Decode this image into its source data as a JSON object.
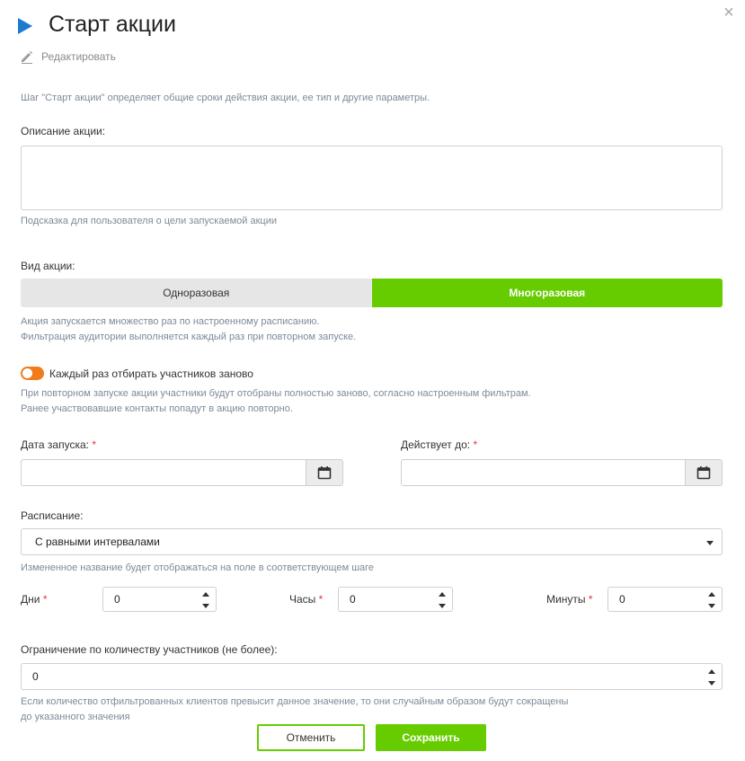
{
  "header": {
    "title": "Старт акции",
    "close_icon": "×",
    "edit_label": "Редактировать"
  },
  "intro_text": "Шаг \"Старт акции\" определяет общие сроки действия акции, ее тип и другие параметры.",
  "description": {
    "label": "Описание акции:",
    "value": "",
    "hint": "Подсказка для пользователя о цели запускаемой акции"
  },
  "type": {
    "label": "Вид акции:",
    "options": [
      "Одноразовая",
      "Многоразовая"
    ],
    "selected": "Многоразовая",
    "hint_line1": "Акция запускается множество раз по настроенному расписанию.",
    "hint_line2": "Фильтрация аудитории выполняется каждый раз при повторном запуске."
  },
  "reselect_toggle": {
    "label": "Каждый раз отбирать участников заново",
    "on": true,
    "hint_line1": "При повторном запуске акции участники будут отобраны полностью заново, согласно настроенным фильтрам.",
    "hint_line2": "Ранее участвовавшие контакты попадут в акцию повторно."
  },
  "start_date": {
    "label": "Дата запуска:",
    "required_mark": "*",
    "value": ""
  },
  "end_date": {
    "label": "Действует до:",
    "required_mark": "*",
    "value": ""
  },
  "schedule": {
    "label": "Расписание:",
    "selected": "С равными интервалами",
    "hint": "Измененное название будет отображаться на поле в соответствующем шаге"
  },
  "interval": {
    "days": {
      "label": "Дни",
      "required_mark": "*",
      "value": "0"
    },
    "hours": {
      "label": "Часы",
      "required_mark": "*",
      "value": "0"
    },
    "minutes": {
      "label": "Минуты",
      "required_mark": "*",
      "value": "0"
    }
  },
  "limit": {
    "label": "Ограничение по количеству участников (не более):",
    "value": "0",
    "hint_line1": "Если количество отфильтрованных клиентов превысит данное значение, то они случайным образом будут сокращены",
    "hint_line2": "до указанного значения"
  },
  "footer": {
    "cancel_label": "Отменить",
    "save_label": "Сохранить"
  },
  "colors": {
    "accent_green": "#66cc00",
    "toggle_orange": "#f07c1c",
    "title_arrow_blue": "#1e7ad0",
    "required_red": "#e0353b"
  },
  "icons": {
    "title": "play-arrow-icon",
    "close": "close-icon",
    "edit": "pencil-icon",
    "calendar": "calendar-icon",
    "dropdown": "caret-down-icon",
    "spinner": "spinner-arrows-icon"
  }
}
